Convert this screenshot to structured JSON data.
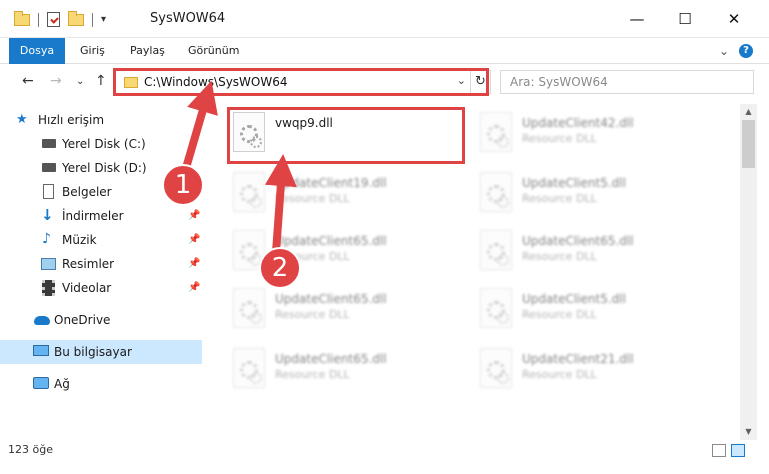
{
  "window": {
    "title": "SysWOW64",
    "qat_menu": "▾",
    "minimize": "—",
    "maximize": "☐",
    "close": "✕"
  },
  "ribbon": {
    "tabs": [
      "Dosya",
      "Giriş",
      "Paylaş",
      "Görünüm"
    ],
    "expand": "⌄",
    "help": "?"
  },
  "nav": {
    "back": "←",
    "forward": "→",
    "recent": "⌄",
    "up": "↑",
    "address": "C:\\Windows\\SysWOW64",
    "address_dropdown": "⌄",
    "refresh": "↻",
    "search_placeholder": "Ara: SysWOW64"
  },
  "sidebar": {
    "items": [
      {
        "label": "Hızlı erişim",
        "icon": "star-icon"
      },
      {
        "label": "Yerel Disk (C:)",
        "icon": "drive-icon"
      },
      {
        "label": "Yerel Disk (D:)",
        "icon": "drive-icon"
      },
      {
        "label": "Belgeler",
        "icon": "documents-icon"
      },
      {
        "label": "İndirmeler",
        "icon": "download-icon"
      },
      {
        "label": "Müzik",
        "icon": "music-icon"
      },
      {
        "label": "Resimler",
        "icon": "pictures-icon"
      },
      {
        "label": "Videolar",
        "icon": "video-icon"
      },
      {
        "label": "OneDrive",
        "icon": "cloud-icon"
      },
      {
        "label": "Bu bilgisayar",
        "icon": "computer-icon"
      },
      {
        "label": "Ağ",
        "icon": "network-icon"
      }
    ],
    "pin": "📌"
  },
  "files": [
    {
      "name": "vwqp9.dll",
      "type": ""
    },
    {
      "name": "UpdateClient42.dll",
      "type": "Resource DLL"
    },
    {
      "name": "UpdateClient19.dll",
      "type": "Resource DLL"
    },
    {
      "name": "UpdateClient5.dll",
      "type": "Resource DLL"
    },
    {
      "name": "UpdateClient65.dll",
      "type": "Resource DLL"
    },
    {
      "name": "UpdateClient65.dll",
      "type": "Resource DLL"
    },
    {
      "name": "UpdateClient65.dll",
      "type": "Resource DLL"
    },
    {
      "name": "UpdateClient5.dll",
      "type": "Resource DLL"
    },
    {
      "name": "UpdateClient65.dll",
      "type": "Resource DLL"
    },
    {
      "name": "UpdateClient21.dll",
      "type": "Resource DLL"
    }
  ],
  "annotations": {
    "step1": "1",
    "step2": "2",
    "color": "#e04343"
  },
  "scroll": {
    "up": "▲",
    "down": "▼"
  },
  "status": {
    "count": "123 öğe"
  },
  "colors": {
    "accent": "#1979ca",
    "selection": "#cce8ff",
    "highlight": "#e04343"
  }
}
